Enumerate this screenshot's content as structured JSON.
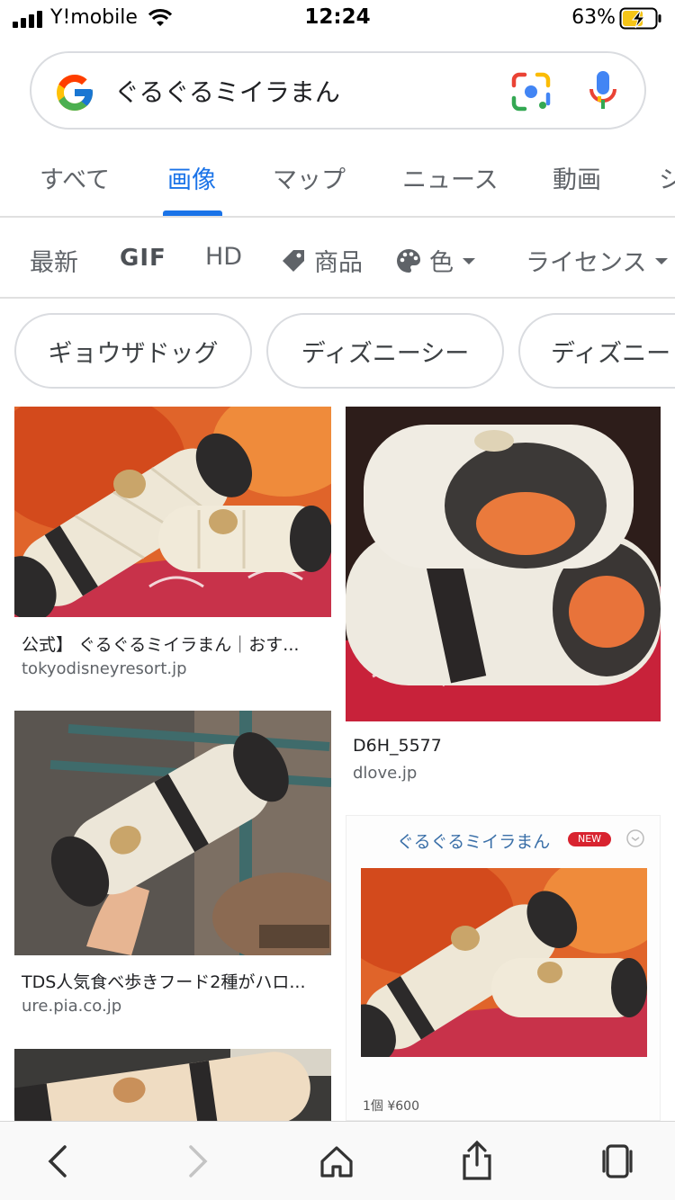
{
  "status_bar": {
    "carrier": "Y!mobile",
    "time": "12:24",
    "battery_percent": "63%",
    "battery_level": 0.63
  },
  "search": {
    "query": "ぐるぐるミイラまん"
  },
  "tabs": [
    {
      "label": "すべて",
      "active": false
    },
    {
      "label": "画像",
      "active": true
    },
    {
      "label": "マップ",
      "active": false
    },
    {
      "label": "ニュース",
      "active": false
    },
    {
      "label": "動画",
      "active": false
    },
    {
      "label": "シ",
      "active": false
    }
  ],
  "filters": {
    "latest": "最新",
    "gif": "GIF",
    "hd": "HD",
    "product": "商品",
    "color": "色",
    "license": "ライセンス"
  },
  "suggestions": [
    "ギョウザドッグ",
    "ディズニーシー",
    "ディズニー"
  ],
  "results": [
    {
      "title": "公式】 ぐるぐるミイラまん｜おす...",
      "source": "tokyodisneyresort.jp"
    },
    {
      "title": "D6H_5577",
      "source": "dlove.jp"
    },
    {
      "title": "TDS人気食べ歩きフード2種がハロ...",
      "source": "ure.pia.co.jp"
    },
    {
      "title": "",
      "source": "",
      "embedded_title": "ぐるぐるミイラまん",
      "embedded_badge": "NEW",
      "embedded_price": "1個 ¥600"
    }
  ],
  "colors": {
    "accent": "#1a73e8",
    "text_secondary": "#5f6368",
    "border": "#dadce0"
  },
  "icons": [
    "google-logo-icon",
    "google-lens-icon",
    "mic-icon",
    "tag-icon",
    "palette-icon",
    "back-icon",
    "forward-icon",
    "home-icon",
    "share-icon",
    "tabs-icon"
  ]
}
